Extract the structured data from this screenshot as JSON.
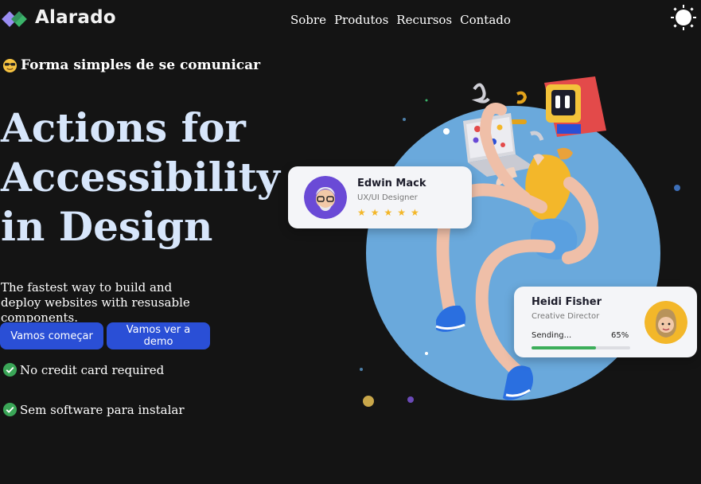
{
  "brand": {
    "name": "Alarado"
  },
  "nav": {
    "items": [
      "Sobre",
      "Produtos",
      "Recursos",
      "Contado"
    ]
  },
  "hero": {
    "eyebrow": "Forma simples de se comunicar",
    "title_lines": [
      "Actions for",
      "Accessibility",
      "in Design"
    ],
    "subtitle": "The fastest way to build and deploy websites with resusable components.",
    "cta_primary": "Vamos começar",
    "cta_secondary": "Vamos ver a demo",
    "checks": [
      "No credit card required",
      "Sem software para instalar"
    ]
  },
  "cards": {
    "edwin": {
      "name": "Edwin Mack",
      "role": "UX/UI Designer",
      "stars": "★★★★★",
      "rating": 5
    },
    "heidi": {
      "name": "Heidi Fisher",
      "role": "Creative Director",
      "status": "Sending...",
      "progress_label": "65%",
      "progress": 0.65
    }
  },
  "colors": {
    "background": "#141414",
    "hero_title": "#d7e6fb",
    "button": "#2a4fd6",
    "circle": "#6aa9dc",
    "progress": "#3cae5a",
    "check": "#3aa657"
  }
}
